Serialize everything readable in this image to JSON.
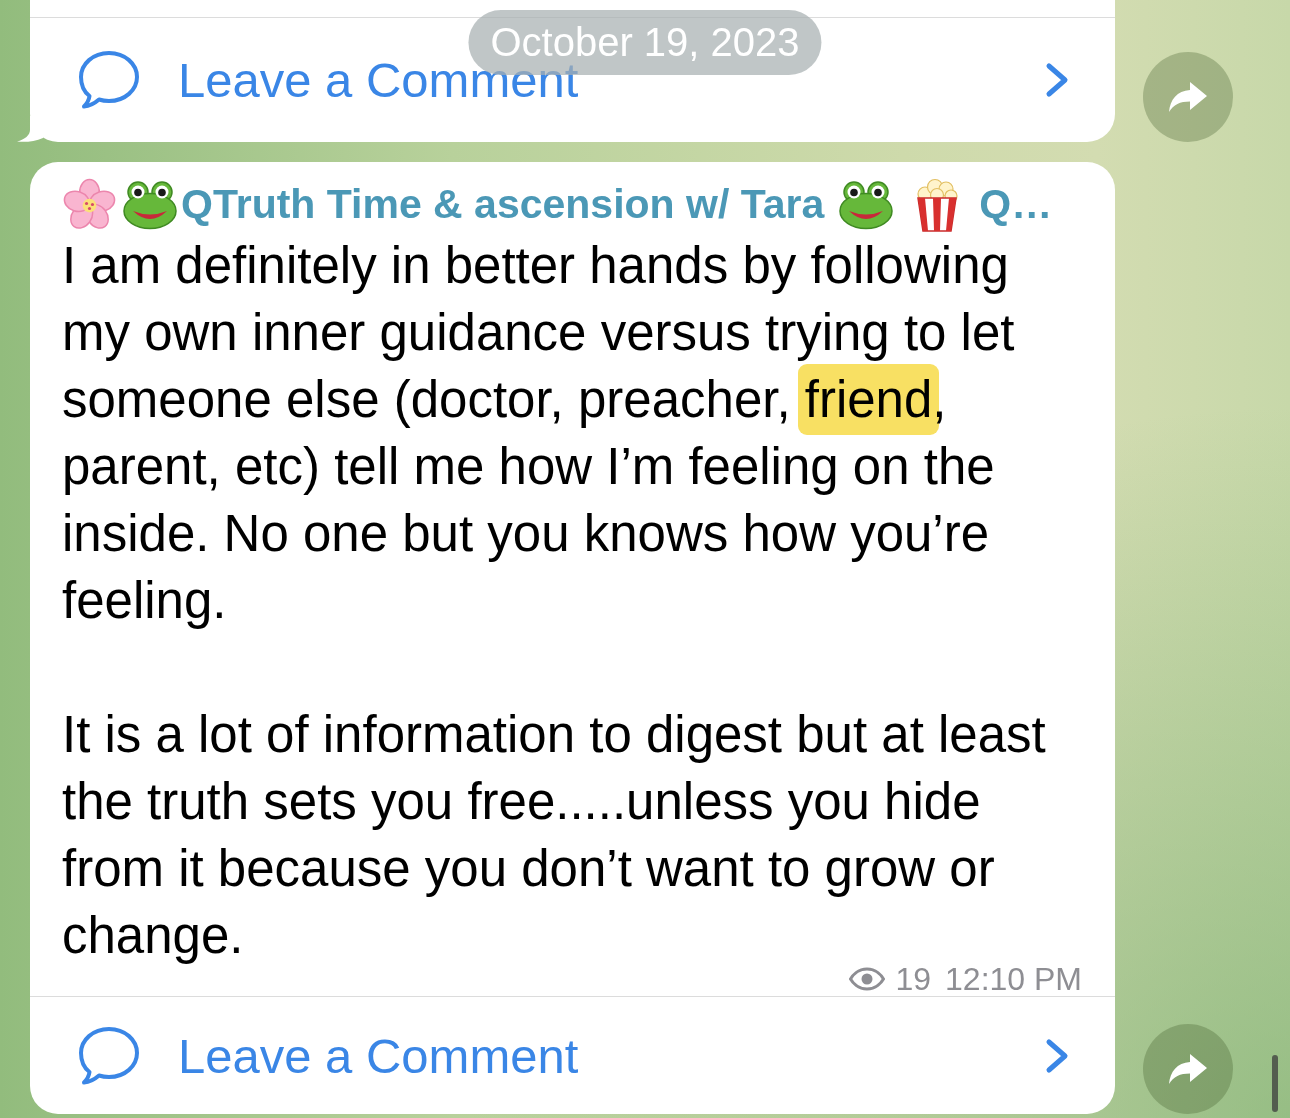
{
  "date_pill": {
    "label": "October 19, 2023"
  },
  "messages": [
    {
      "tail": true,
      "comment_link": {
        "label": "Leave a Comment"
      }
    },
    {
      "tail": false,
      "sender": {
        "name": "QTruth Time & ascension w/ Tara",
        "name_overflow": "Q…"
      },
      "paragraphs": [
        {
          "segments": [
            {
              "text": "I am definitely in better hands by following my own inner guidance versus trying to let someone else (doctor, preacher, ",
              "highlighted": false
            },
            {
              "text": "friend",
              "highlighted": true
            },
            {
              "text": ", parent, etc) tell me how I’m feeling on the inside. No one but you knows how you’re feeling.",
              "highlighted": false
            }
          ]
        },
        {
          "segments": [
            {
              "text": "It is a lot of information to digest but at least the truth sets you free.....unless you hide from it because you don’t want to grow or change.",
              "highlighted": false
            }
          ]
        }
      ],
      "views": "19",
      "time": "12:10 PM",
      "comment_link": {
        "label": "Leave a Comment"
      }
    }
  ]
}
